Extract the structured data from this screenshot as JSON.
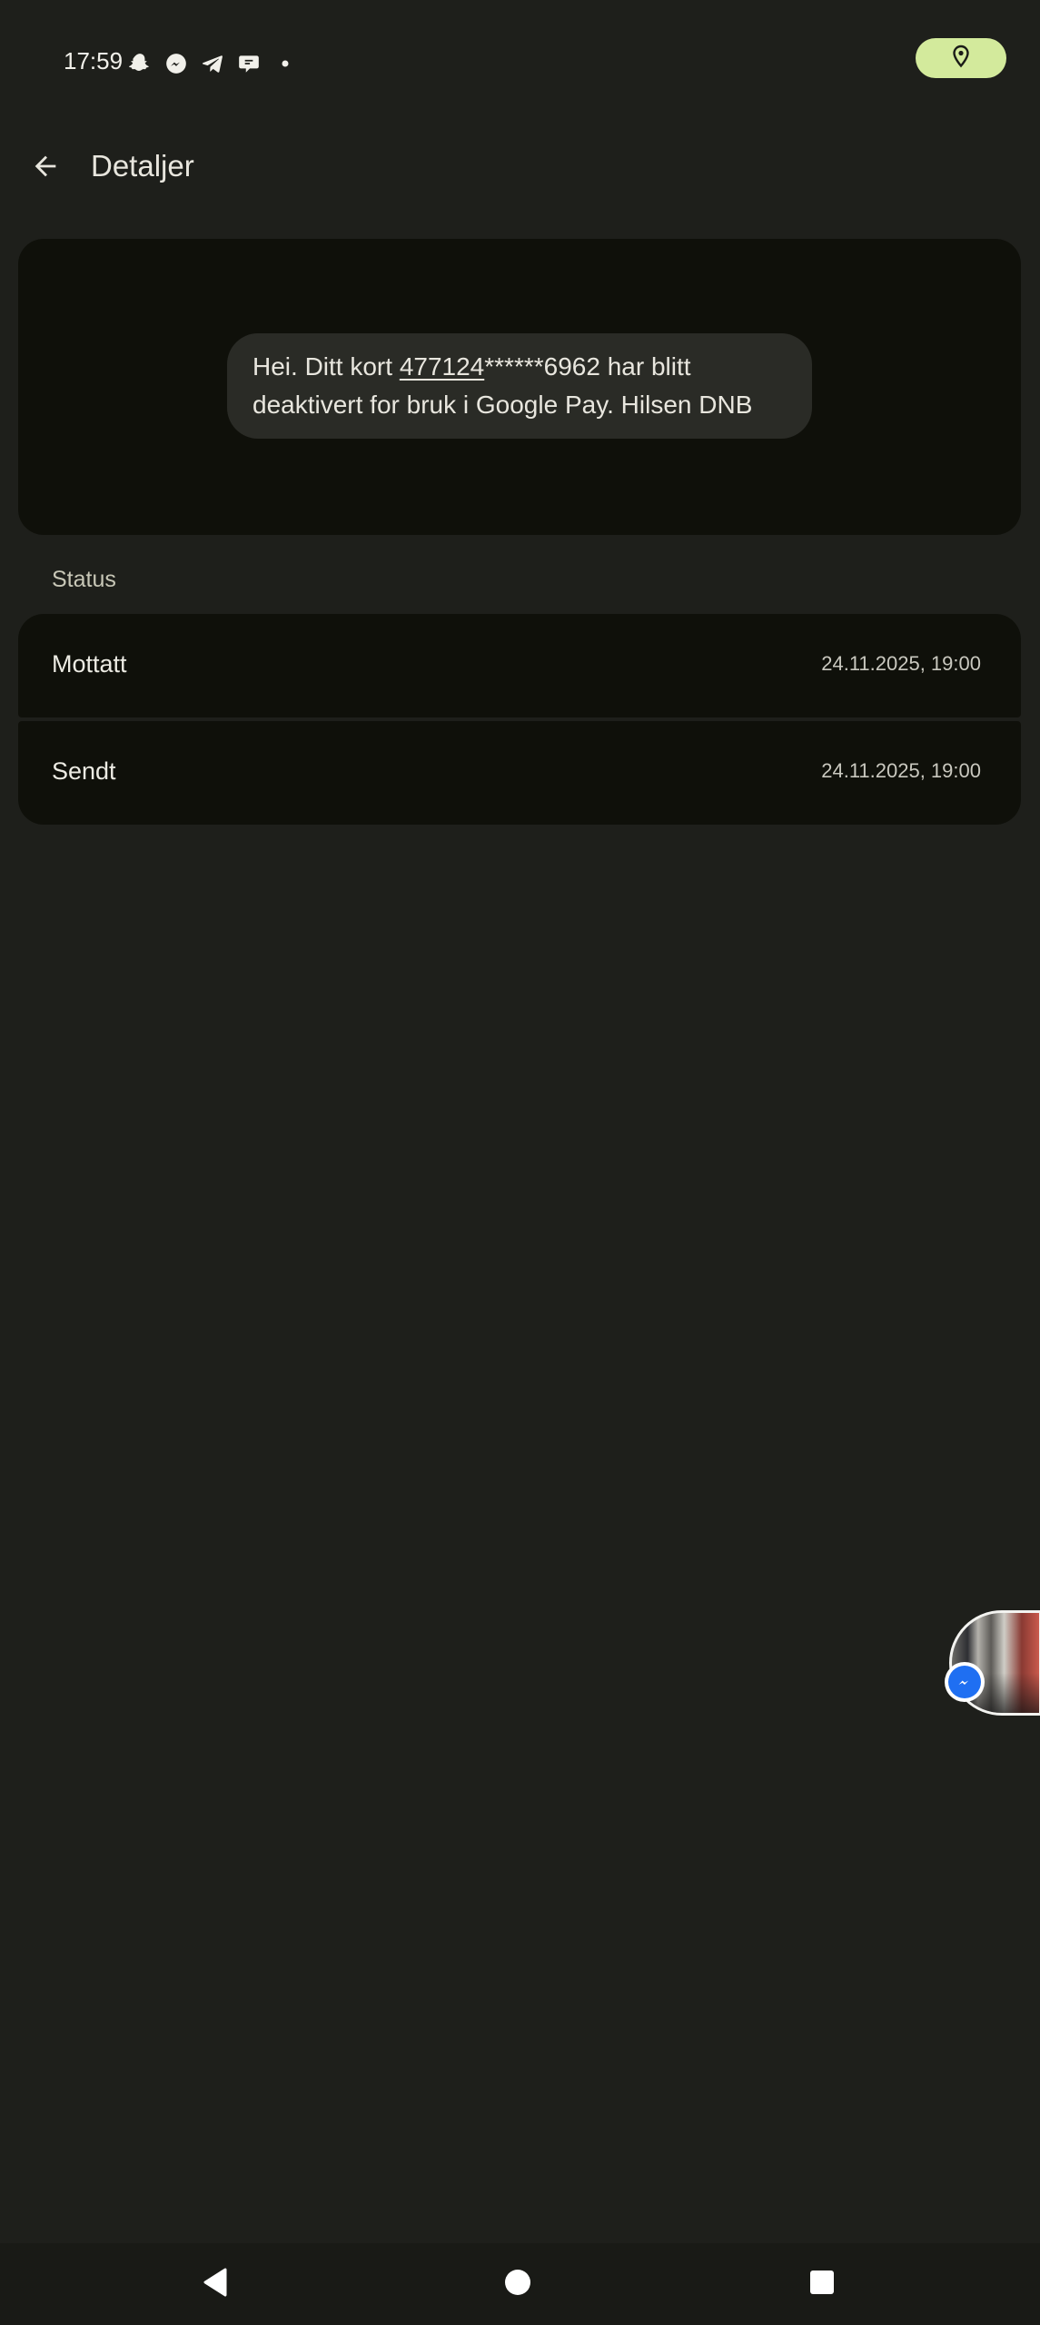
{
  "status_bar": {
    "time": "17:59",
    "notification_icons": [
      "snapchat-icon",
      "messenger-icon",
      "telegram-icon",
      "chat-bubble-icon",
      "dot-icon"
    ],
    "location_pill_color": "#d3ea9c",
    "location_icon": "location-pin-icon"
  },
  "app_bar": {
    "back_icon": "arrow-back-icon",
    "title": "Detaljer"
  },
  "message": {
    "line1_prefix": "Hei. Ditt kort ",
    "line1_link": "477124",
    "line1_suffix": "******6962 har blitt",
    "line2": "deaktivert for bruk i Google Pay. Hilsen DNB"
  },
  "status_section": {
    "title": "Status",
    "rows": [
      {
        "label": "Mottatt",
        "time": "24.11.2025, 19:00"
      },
      {
        "label": "Sendt",
        "time": "24.11.2025, 19:00"
      }
    ]
  },
  "chat_head": {
    "badge_icon": "messenger-icon",
    "badge_color": "#1f6ff2"
  },
  "nav_bar": {
    "back_icon": "nav-back-icon",
    "home_icon": "nav-home-icon",
    "recents_icon": "nav-recents-icon"
  },
  "colors": {
    "background": "#1e1f1b",
    "card": "#0f100a",
    "bubble": "#2a2b26",
    "text": "#e8e6de"
  }
}
